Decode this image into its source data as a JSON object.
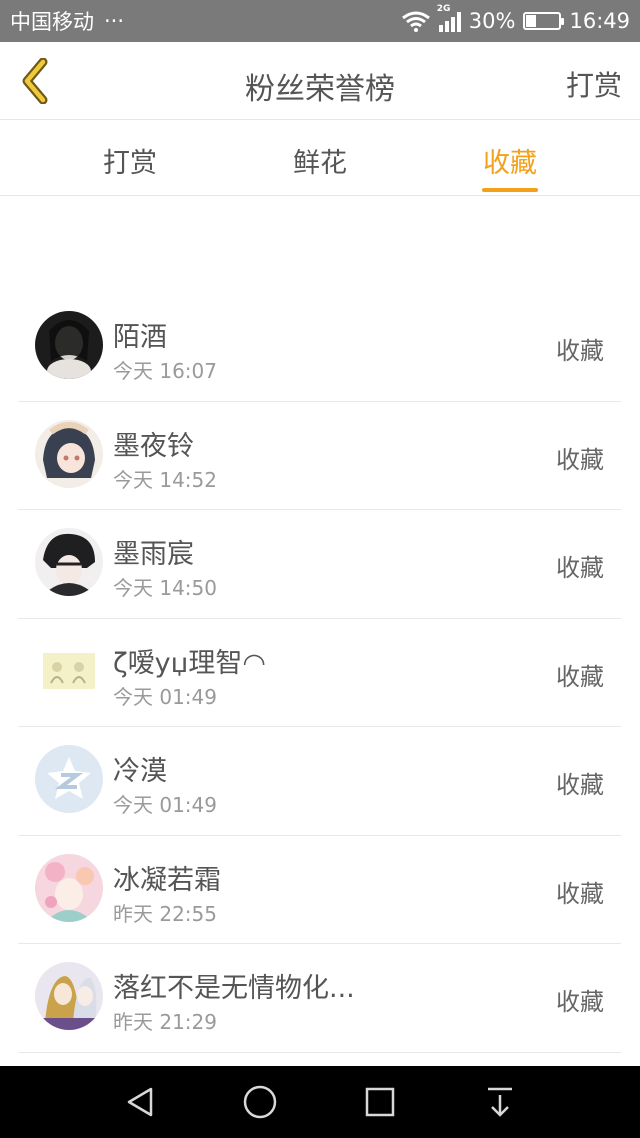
{
  "status_bar": {
    "carrier": "中国移动",
    "dots": "···",
    "network": "2G",
    "battery": "30%",
    "battery_level": 0.3,
    "time": "16:49"
  },
  "header": {
    "title": "粉丝荣誉榜",
    "action": "打赏"
  },
  "tabs": [
    {
      "label": "打赏",
      "active": false
    },
    {
      "label": "鲜花",
      "active": false
    },
    {
      "label": "收藏",
      "active": true
    }
  ],
  "accent_color": "#f3a11a",
  "list": [
    {
      "name": "陌酒",
      "time": "今天 16:07",
      "action": "收藏"
    },
    {
      "name": "墨夜铃",
      "time": "今天 14:52",
      "action": "收藏"
    },
    {
      "name": "墨雨宸",
      "time": "今天 14:50",
      "action": "收藏"
    },
    {
      "name": "ζ嗳yџ理智◠",
      "time": "今天 01:49",
      "action": "收藏"
    },
    {
      "name": "冷漠",
      "time": "今天 01:49",
      "action": "收藏"
    },
    {
      "name": "冰凝若霜",
      "time": "昨天 22:55",
      "action": "收藏"
    },
    {
      "name": "落红不是无情物化...",
      "time": "昨天 21:29",
      "action": "收藏"
    }
  ],
  "nav": [
    "back-icon",
    "home-icon",
    "recents-icon",
    "notification-pull-icon"
  ]
}
